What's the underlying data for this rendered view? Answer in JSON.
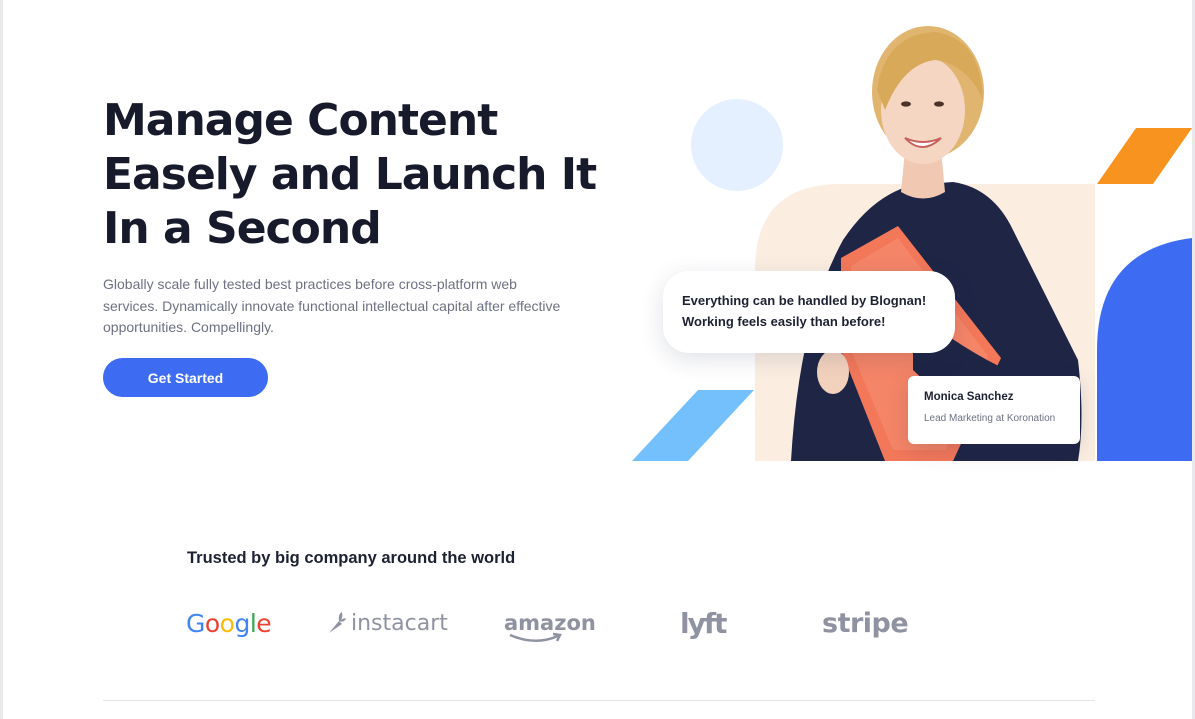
{
  "hero": {
    "title_lines": [
      "Manage Content",
      "Easely and Launch It",
      "In a Second"
    ],
    "description": "Globally scale fully tested best practices before cross-platform web services. Dynamically innovate functional intellectual capital after effective opportunities. Compellingly.",
    "cta_label": "Get Started"
  },
  "testimonial": {
    "quote_lines": [
      "Everything can be handled by Blognan!",
      "Working feels easily than before!"
    ],
    "name": "Monica Sanchez",
    "role": "Lead Marketing at Koronation"
  },
  "trusted": {
    "heading": "Trusted by big company around the world",
    "logos": [
      {
        "name": "google",
        "text": "Google"
      },
      {
        "name": "instacart",
        "text": "instacart"
      },
      {
        "name": "amazon",
        "text": "amazon"
      },
      {
        "name": "lyft",
        "text": "lyft"
      },
      {
        "name": "stripe",
        "text": "stripe"
      }
    ]
  },
  "colors": {
    "accent_blue": "#3d6cf2",
    "light_blue": "#74c0fc",
    "orange": "#f7931e",
    "peach": "#fbeee1",
    "pale_blue_circle": "#e4efff",
    "heading_dark": "#161a2b"
  },
  "icons": {
    "instacart": "carrot-icon",
    "amazon": "amazon-smile-icon"
  }
}
